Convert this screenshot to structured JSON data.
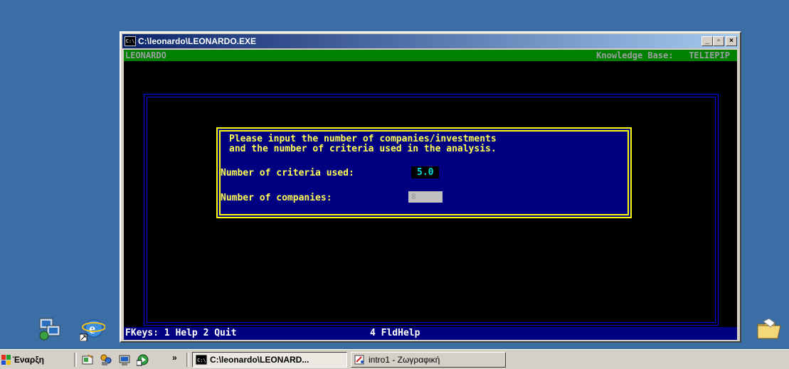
{
  "window": {
    "title": "C:\\leonardo\\LEONARDO.EXE",
    "title_icon_text": "C:\\",
    "controls": {
      "minimize": "_",
      "maximize": "▫",
      "close": "×"
    }
  },
  "console": {
    "app_name": "LEONARDO",
    "kb_label": "Knowledge Base:",
    "kb_value": "TELIEPIP",
    "prompt_line1": "Please input the number of companies/investments",
    "prompt_line2": "and the number of criteria used in the analysis.",
    "criteria_label": "Number of criteria used:",
    "criteria_value": "5.0",
    "companies_label": "Number of companies:",
    "companies_value": "8",
    "fkeys_left": "FKeys: 1 Help 2 Quit",
    "fkeys_mid": "4 FldHelp"
  },
  "taskbar": {
    "start_label": "Έναρξη",
    "chevron": "»",
    "tasks": [
      {
        "label": "C:\\leonardo\\LEONARD...",
        "active": true
      },
      {
        "label": "intro1 - Ζωγραφική",
        "active": false
      }
    ]
  },
  "colors": {
    "desktop": "#3a6ea5",
    "status_bar": "#008000",
    "dialog_bg": "#000080",
    "dialog_border": "#ffff00",
    "fkey_bar": "#000080"
  }
}
